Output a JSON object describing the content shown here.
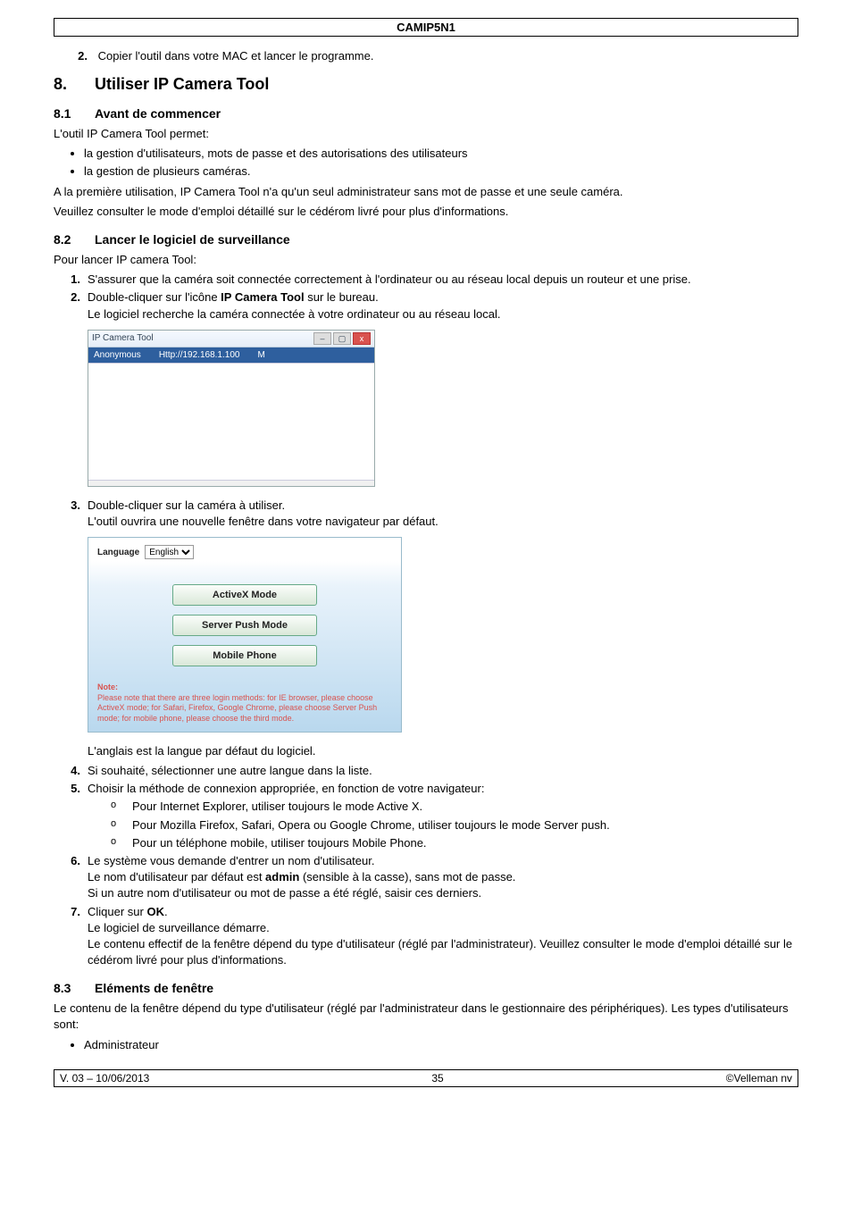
{
  "header": {
    "code": "CAMIP5N1"
  },
  "step2": {
    "n": "2.",
    "text": "Copier l'outil dans votre MAC et lancer le programme."
  },
  "sec8": {
    "num": "8.",
    "title": "Utiliser IP Camera Tool"
  },
  "s81": {
    "num": "8.1",
    "title": "Avant de commencer",
    "intro": "L'outil IP Camera Tool permet:",
    "b1": "la gestion d'utilisateurs, mots de passe et des autorisations des utilisateurs",
    "b2": "la gestion de plusieurs caméras.",
    "p1": "A la première utilisation, IP Camera Tool n'a qu'un seul administrateur sans mot de passe et une seule caméra.",
    "p2": "Veuillez consulter le mode d'emploi détaillé sur le cédérom livré pour plus d'informations."
  },
  "s82": {
    "num": "8.2",
    "title": "Lancer le logiciel de surveillance",
    "intro": "Pour lancer IP camera Tool:",
    "st1": {
      "n": "1.",
      "t": "S'assurer que la caméra soit connectée correctement à l'ordinateur ou au réseau local depuis un routeur et une prise."
    },
    "st2": {
      "n": "2.",
      "t_a": "Double-cliquer sur l'icône ",
      "t_bold": "IP Camera Tool",
      "t_b": " sur le bureau.",
      "t_c": "Le logiciel recherche la caméra connectée à votre ordinateur ou au réseau local."
    },
    "st3": {
      "n": "3.",
      "t_a": "Double-cliquer sur la caméra à utiliser.",
      "t_b": "L'outil ouvrira une nouvelle fenêtre dans votre navigateur par défaut."
    },
    "lang_note": "L'anglais est la langue par défaut du logiciel.",
    "st4": {
      "n": "4.",
      "t": "Si souhaité, sélectionner une autre langue dans la liste."
    },
    "st5": {
      "n": "5.",
      "t": "Choisir la méthode de connexion appropriée, en fonction de votre navigateur:",
      "o1": "Pour Internet Explorer, utiliser toujours le mode Active X.",
      "o2": "Pour Mozilla Firefox, Safari, Opera ou Google Chrome, utiliser toujours le mode Server push.",
      "o3": "Pour un téléphone mobile, utiliser toujours Mobile Phone."
    },
    "st6": {
      "n": "6.",
      "t_a": "Le système vous demande d'entrer un nom d'utilisateur.",
      "t_b1": "Le nom d'utilisateur par défaut est ",
      "t_bold": "admin",
      "t_b2": " (sensible à la casse), sans mot de passe.",
      "t_c": "Si un autre nom d'utilisateur ou mot de passe a été réglé, saisir ces derniers."
    },
    "st7": {
      "n": "7.",
      "t_a": "Cliquer sur ",
      "t_bold": "OK",
      "t_a2": ".",
      "t_b": "Le logiciel de surveillance démarre.",
      "t_c": "Le contenu effectif de la fenêtre dépend du type d'utilisateur (réglé par l'administrateur). Veuillez consulter le mode d'emploi détaillé sur le cédérom livré pour plus d'informations."
    }
  },
  "s83": {
    "num": "8.3",
    "title": "Eléments de fenêtre",
    "p1": "Le contenu de la fenêtre dépend du type d'utilisateur (réglé par l'administrateur dans le gestionnaire des périphériques). Les types d'utilisateurs sont:",
    "b1": "Administrateur"
  },
  "fig1": {
    "title": "IP Camera Tool",
    "col1": "Anonymous",
    "col2": "Http://192.168.1.100",
    "col3": "M"
  },
  "fig2": {
    "lang_label": "Language",
    "lang_value": "English",
    "btn1": "ActiveX Mode",
    "btn2": "Server Push Mode",
    "btn3": "Mobile Phone",
    "note_title": "Note:",
    "note_body": "Please note that there are three login methods: for IE browser, please choose ActiveX mode; for Safari, Firefox, Google Chrome, please choose Server Push mode; for mobile phone, please choose the third mode."
  },
  "footer": {
    "left": "V. 03 – 10/06/2013",
    "center": "35",
    "right": "©Velleman nv"
  }
}
